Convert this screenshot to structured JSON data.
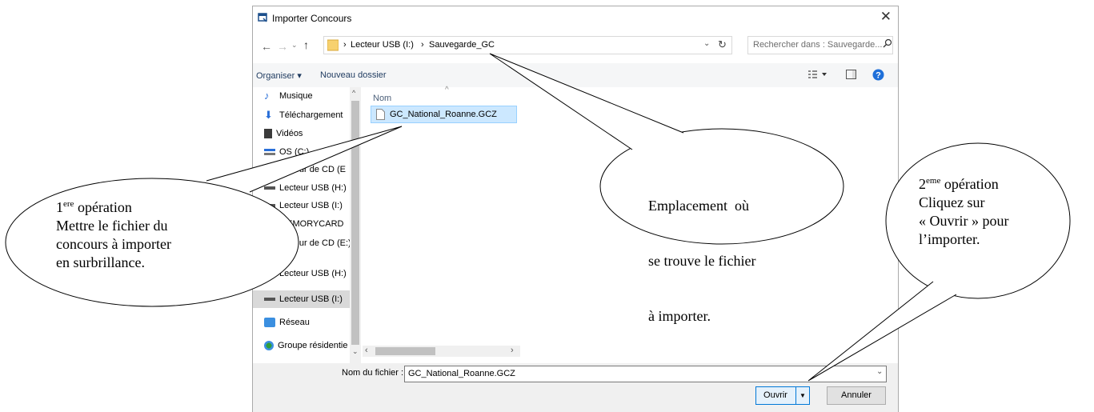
{
  "dialog": {
    "title": "Importer Concours",
    "address": {
      "drive": "Lecteur USB (I:)",
      "folder": "Sauvegarde_GC"
    },
    "search_placeholder": "Rechercher dans : Sauvegarde...",
    "toolbar": {
      "organize": "Organiser ▾",
      "new_folder": "Nouveau dossier"
    },
    "nav_items": [
      {
        "label": "Musique",
        "icon": "music-note-icon",
        "selected": false
      },
      {
        "label": "Téléchargement",
        "icon": "download-arrow-icon",
        "selected": false
      },
      {
        "label": "Vidéos",
        "icon": "film-icon",
        "selected": false
      },
      {
        "label": "OS (C:)",
        "icon": "windows-drive-icon",
        "selected": false
      },
      {
        "label": "Lecteur de CD (E",
        "icon": "cd-drive-icon",
        "selected": false
      },
      {
        "label": "Lecteur USB (H:)",
        "icon": "usb-drive-icon",
        "selected": false
      },
      {
        "label": "Lecteur USB (I:)",
        "icon": "usb-drive-icon",
        "selected": false
      },
      {
        "label": "MEMORYCARD",
        "icon": "memory-card-icon",
        "selected": false
      },
      {
        "label": "Lecteur de CD (E:)",
        "icon": "cd-drive-icon",
        "selected": false
      },
      {
        "label": "Lecteur USB (H:)",
        "icon": "usb-drive-icon",
        "selected": false
      },
      {
        "label": "Lecteur USB (I:)",
        "icon": "usb-drive-icon",
        "selected": true
      },
      {
        "label": "Réseau",
        "icon": "network-icon",
        "selected": false
      },
      {
        "label": "Groupe résidentie",
        "icon": "homegroup-icon",
        "selected": false
      }
    ],
    "column_header": "Nom",
    "files": [
      {
        "name": "GC_National_Roanne.GCZ",
        "selected": true
      }
    ],
    "filename_label": "Nom du fichier :",
    "filename_value": "GC_National_Roanne.GCZ",
    "open_button": "Ouvrir",
    "cancel_button": "Annuler",
    "colors": {
      "accent": "#0078d7",
      "selection": "#cce8ff",
      "help": "#1e6fd9"
    }
  },
  "callouts": {
    "step1": {
      "line1_sup": "ere",
      "line1_text": " opération",
      "line1_num": "1",
      "line2": "Mettre le fichier du",
      "line3": "concours à importer",
      "line4": "en surbrillance."
    },
    "location": {
      "line1": "Emplacement  où",
      "line2": "se trouve le fichier",
      "line3": "à importer."
    },
    "step2": {
      "line1_num": "2",
      "line1_sup": "eme",
      "line1_text": " opération",
      "line2": "Cliquez sur",
      "line3": "« Ouvrir » pour",
      "line4": "l’importer."
    }
  }
}
